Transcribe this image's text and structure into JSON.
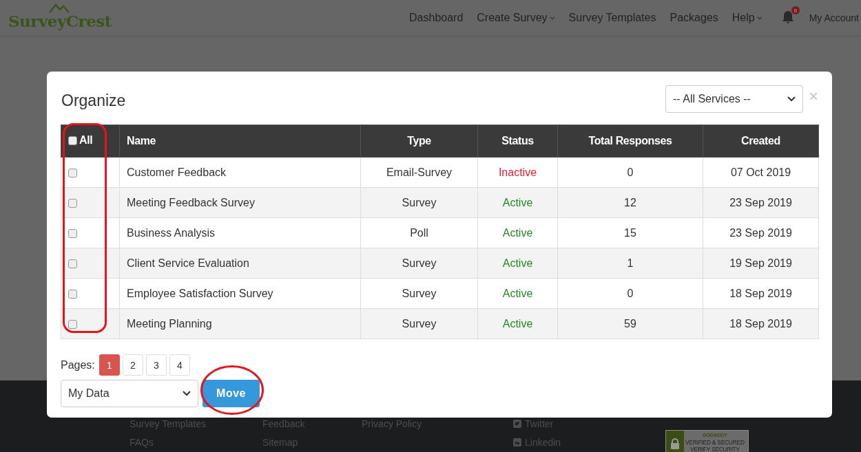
{
  "header": {
    "logo": "SurveyCrest",
    "nav": [
      {
        "label": "Dashboard",
        "dropdown": false
      },
      {
        "label": "Create Survey",
        "dropdown": true
      },
      {
        "label": "Survey Templates",
        "dropdown": false
      },
      {
        "label": "Packages",
        "dropdown": false
      },
      {
        "label": "Help",
        "dropdown": true
      }
    ],
    "notifications": "0",
    "account": "My Account"
  },
  "modal": {
    "title": "Organize",
    "service_filter": "-- All Services --",
    "close": "×",
    "select_all": {
      "label": "All",
      "checked": false
    },
    "columns": [
      "Name",
      "Type",
      "Status",
      "Total Responses",
      "Created"
    ],
    "rows": [
      {
        "checked": false,
        "name": "Customer Feedback",
        "type": "Email-Survey",
        "status": "Inactive",
        "active": false,
        "responses": "0",
        "created": "07 Oct 2019"
      },
      {
        "checked": false,
        "name": "Meeting Feedback Survey",
        "type": "Survey",
        "status": "Active",
        "active": true,
        "responses": "12",
        "created": "23 Sep 2019"
      },
      {
        "checked": false,
        "name": "Business Analysis",
        "type": "Poll",
        "status": "Active",
        "active": true,
        "responses": "15",
        "created": "23 Sep 2019"
      },
      {
        "checked": false,
        "name": "Client Service Evaluation",
        "type": "Survey",
        "status": "Active",
        "active": true,
        "responses": "1",
        "created": "19 Sep 2019"
      },
      {
        "checked": false,
        "name": "Employee Satisfaction Survey",
        "type": "Survey",
        "status": "Active",
        "active": true,
        "responses": "0",
        "created": "18 Sep 2019"
      },
      {
        "checked": false,
        "name": "Meeting Planning",
        "type": "Survey",
        "status": "Active",
        "active": true,
        "responses": "59",
        "created": "18 Sep 2019"
      }
    ],
    "pages_label": "Pages:",
    "pages": [
      {
        "label": "1",
        "selected": true
      },
      {
        "label": "2",
        "selected": false
      },
      {
        "label": "3",
        "selected": false
      },
      {
        "label": "4",
        "selected": false
      }
    ],
    "destination": "My Data",
    "move_button": "Move"
  },
  "footer": {
    "links": [
      [
        "Survey Templates",
        "FAQs"
      ],
      [
        "Feedback",
        "Sitemap"
      ],
      [
        "Privacy Policy"
      ]
    ],
    "social": [
      {
        "kind": "twitter",
        "label": "Twitter"
      },
      {
        "kind": "linkedin",
        "label": "Linkedin"
      }
    ],
    "badge": {
      "brand": "GODADDY",
      "title": "VERIFIED & SECURED",
      "subtitle": "VERIFY SECURITY"
    }
  }
}
